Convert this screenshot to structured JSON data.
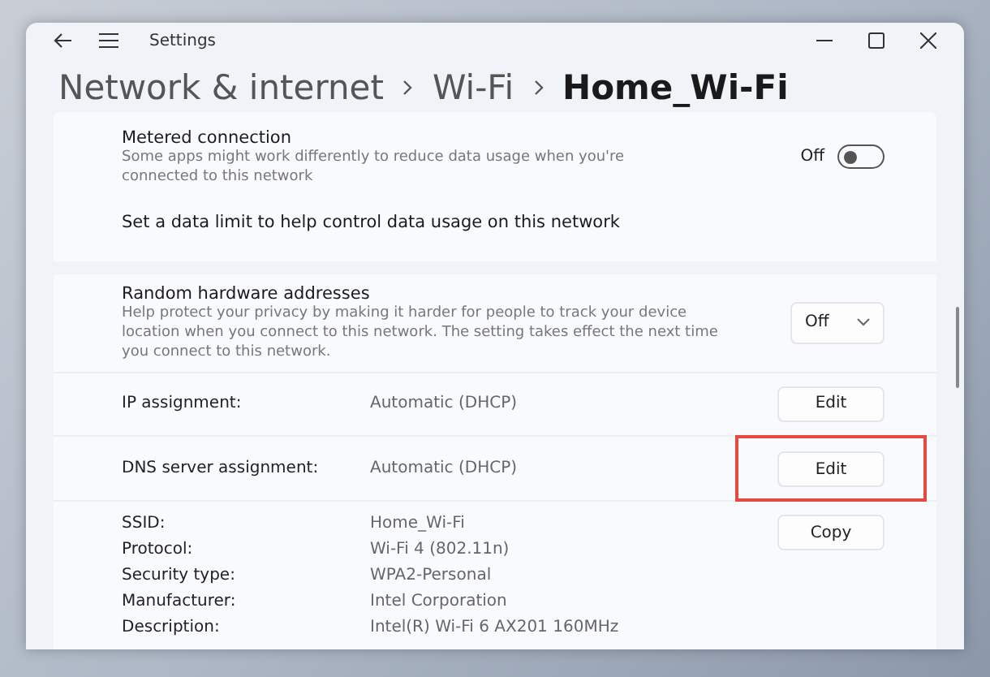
{
  "window": {
    "title": "Settings"
  },
  "breadcrumb": [
    {
      "label": "Network & internet",
      "current": false
    },
    {
      "label": "Wi-Fi",
      "current": false
    },
    {
      "label": "Home_Wi-Fi",
      "current": true
    }
  ],
  "metered": {
    "title": "Metered connection",
    "description": "Some apps might work differently to reduce data usage when you're connected to this network",
    "state_label": "Off",
    "on": false
  },
  "data_limit": {
    "label": "Set a data limit to help control data usage on this network"
  },
  "random_hardware": {
    "title": "Random hardware addresses",
    "description": "Help protect your privacy by making it harder for people to track your device location when you connect to this network. The setting takes effect the next time you connect to this network.",
    "value": "Off"
  },
  "assignments": [
    {
      "label": "IP assignment:",
      "value": "Automatic (DHCP)",
      "button": "Edit",
      "highlighted": false
    },
    {
      "label": "DNS server assignment:",
      "value": "Automatic (DHCP)",
      "button": "Edit",
      "highlighted": true
    }
  ],
  "properties": {
    "button": "Copy",
    "rows": [
      {
        "label": "SSID:",
        "value": "Home_Wi-Fi"
      },
      {
        "label": "Protocol:",
        "value": "Wi-Fi 4 (802.11n)"
      },
      {
        "label": "Security type:",
        "value": "WPA2-Personal"
      },
      {
        "label": "Manufacturer:",
        "value": "Intel Corporation"
      },
      {
        "label": "Description:",
        "value": "Intel(R) Wi-Fi 6 AX201 160MHz"
      }
    ]
  }
}
